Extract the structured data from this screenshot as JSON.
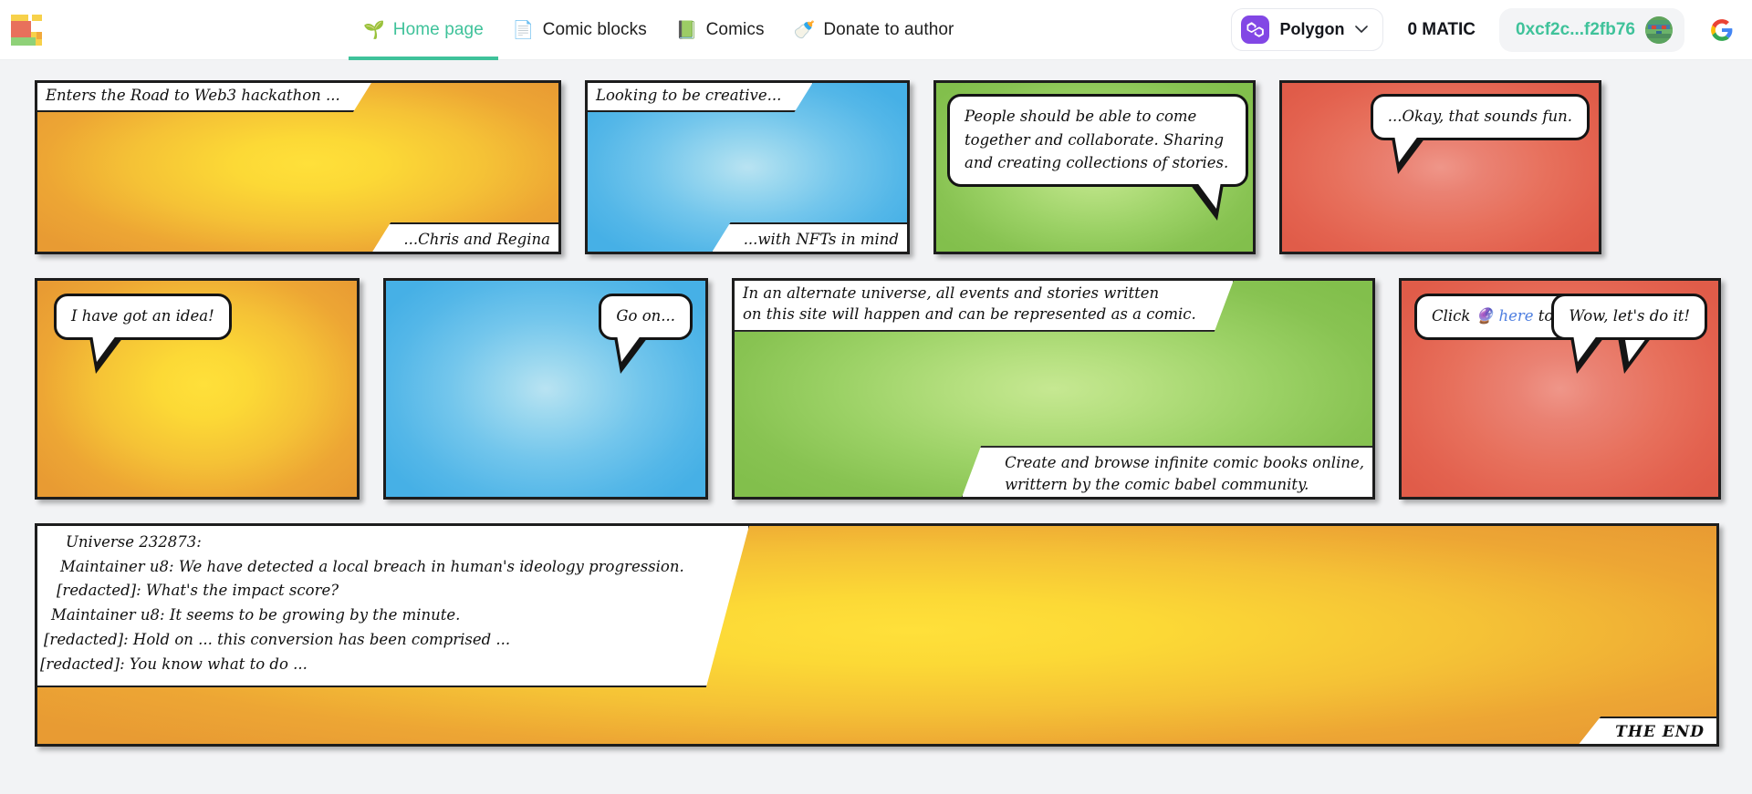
{
  "header": {
    "logo_name": "comic-babel-logo",
    "nav": [
      {
        "emoji": "🌱",
        "label": "Home page",
        "active": true
      },
      {
        "emoji": "📄",
        "label": "Comic blocks",
        "active": false
      },
      {
        "emoji": "📗",
        "label": "Comics",
        "active": false
      },
      {
        "emoji": "🍼",
        "label": "Donate to author",
        "active": false
      }
    ],
    "chain": {
      "name": "Polygon",
      "caret": "chevron-down-icon",
      "accent": "#8247e5"
    },
    "balance": "0 MATIC",
    "address": "0xcf2c...f2fb76",
    "google_sign_in": "G",
    "accent_green": "#3fc29a"
  },
  "comic": {
    "row1": [
      {
        "id": "panel-1",
        "color": "yellow",
        "caption_top": "Enters the Road to Web3 hackathon ...",
        "caption_bottom": "...Chris and Regina"
      },
      {
        "id": "panel-2",
        "color": "blue",
        "caption_top": "Looking to be creative...",
        "caption_bottom": "...with NFTs in mind"
      },
      {
        "id": "panel-3",
        "color": "green",
        "bubble": "People should be able to come together and collaborate. Sharing and creating collections of stories."
      },
      {
        "id": "panel-4",
        "color": "red",
        "bubble": "...Okay, that sounds fun."
      }
    ],
    "row2": [
      {
        "id": "panel-5",
        "color": "yellow",
        "bubble": "I have got an idea!"
      },
      {
        "id": "panel-6",
        "color": "blue",
        "bubble": "Go on..."
      },
      {
        "id": "panel-7",
        "color": "green",
        "caption_top_line1": "In an alternate universe, all events and stories written",
        "caption_top_line2": "on this site will happen and can be represented as a comic.",
        "caption_bottom_line1": "Create and browse infinite comic books online,",
        "caption_bottom_line2": "writtern by the comic babel community."
      },
      {
        "id": "panel-8",
        "color": "red",
        "bubble_a_pre": "Click ",
        "bubble_a_emoji": "🔮",
        "bubble_a_link": " here",
        "bubble_a_post": " to make history",
        "bubble_b": "Wow, let's do it!"
      }
    ],
    "bottom": {
      "id": "panel-9",
      "color": "yellow",
      "caption_lines": [
        "Universe 232873:",
        "Maintainer u8: We have detected a local breach in human's ideology progression.",
        "[redacted]: What's the impact score?",
        "Maintainer u8: It seems to be growing by the minute.",
        "[redacted]: Hold on ... this conversion has been comprised ...",
        "[redacted]: You know what to do ..."
      ],
      "the_end": "THE END"
    }
  }
}
